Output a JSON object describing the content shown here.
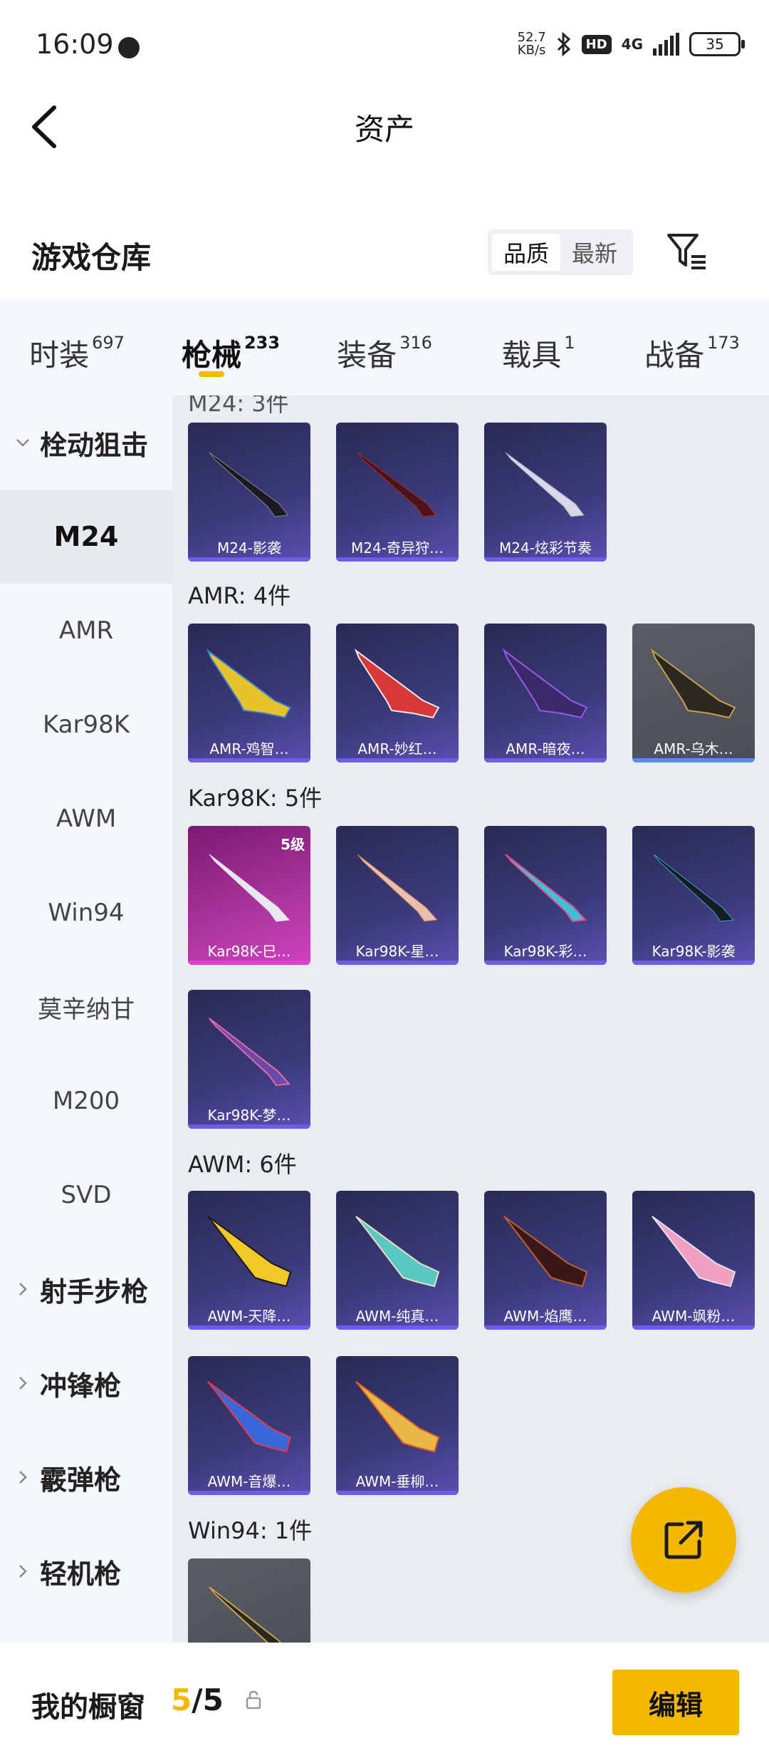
{
  "status": {
    "time": "16:09",
    "net_speed_value": "52.7",
    "net_speed_unit": "KB/s",
    "hd": "HD",
    "network": "4G",
    "battery": "35"
  },
  "header": {
    "title": "资产"
  },
  "section": {
    "title": "游戏仓库",
    "sort_options": [
      "品质",
      "最新"
    ],
    "active_sort": "品质"
  },
  "tabs": [
    {
      "label": "时装",
      "count": "697"
    },
    {
      "label": "枪械",
      "count": "233"
    },
    {
      "label": "装备",
      "count": "316"
    },
    {
      "label": "载具",
      "count": "1"
    },
    {
      "label": "战备",
      "count": "173"
    }
  ],
  "sidebar": {
    "group_open": "栓动狙击",
    "items": [
      "M24",
      "AMR",
      "Kar98K",
      "AWM",
      "Win94",
      "莫辛纳甘",
      "M200",
      "SVD"
    ],
    "active": "M24",
    "groups_collapsed": [
      "射手步枪",
      "冲锋枪",
      "霰弹枪",
      "轻机枪"
    ]
  },
  "content": {
    "partial_header": "M24: 3件",
    "categories": [
      {
        "title": "AMR: 4件"
      },
      {
        "title": "Kar98K: 5件"
      },
      {
        "title": "AWM: 6件"
      },
      {
        "title": "Win94: 1件"
      }
    ],
    "cards": {
      "m24": [
        "M24-影袭",
        "M24-奇异狩…",
        "M24-炫彩节奏"
      ],
      "amr": [
        "AMR-鸡智…",
        "AMR-妙红…",
        "AMR-暗夜…",
        "AMR-乌木…"
      ],
      "kar": [
        "Kar98K-巳…",
        "Kar98K-星…",
        "Kar98K-彩…",
        "Kar98K-影袭",
        "Kar98K-梦…"
      ],
      "awm": [
        "AWM-天降…",
        "AWM-纯真…",
        "AWM-焰鹰…",
        "AWM-飒粉…",
        "AWM-音爆…",
        "AWM-垂柳…"
      ]
    },
    "kar_level": "5级"
  },
  "bottom": {
    "label": "我的橱窗",
    "current": "5",
    "sep": "/",
    "total": "5",
    "edit": "编辑"
  }
}
